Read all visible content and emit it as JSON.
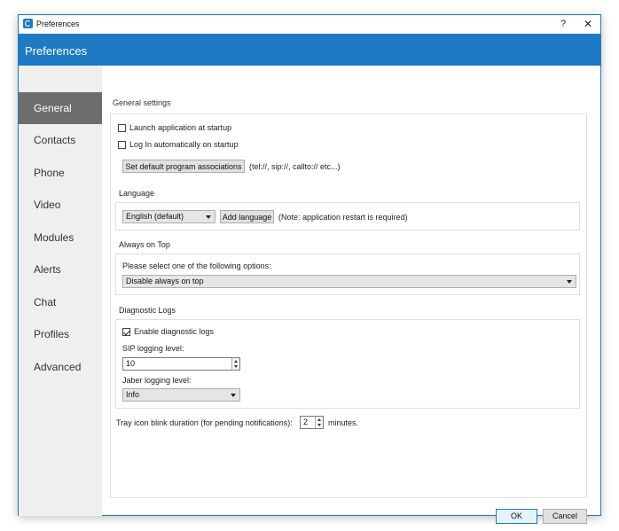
{
  "window": {
    "title": "Preferences",
    "help_label": "?",
    "close_label": "✕"
  },
  "header": {
    "title": "Preferences"
  },
  "sidebar": {
    "items": [
      {
        "label": "General",
        "active": true
      },
      {
        "label": "Contacts"
      },
      {
        "label": "Phone"
      },
      {
        "label": "Video"
      },
      {
        "label": "Modules"
      },
      {
        "label": "Alerts"
      },
      {
        "label": "Chat"
      },
      {
        "label": "Profiles"
      },
      {
        "label": "Advanced"
      }
    ]
  },
  "general": {
    "section_title": "General settings",
    "launch_at_startup": {
      "label": "Launch application at startup",
      "checked": false
    },
    "login_on_startup": {
      "label": "Log In automatically on startup",
      "checked": false
    },
    "set_default_button": "Set default program associations",
    "associations_note": "(tel://, sip://, callto:// etc...)"
  },
  "language": {
    "section_title": "Language",
    "selected": "English (default)",
    "add_button": "Add language",
    "note": "(Note: application restart is required)"
  },
  "always_on_top": {
    "section_title": "Always on Top",
    "prompt": "Please select one of the following options:",
    "selected": "Disable always on top"
  },
  "diagnostic_logs": {
    "section_title": "Diagnostic Logs",
    "enable": {
      "label": "Enable diagnostic logs",
      "checked": true
    },
    "sip_label": "SIP logging level:",
    "sip_value": "10",
    "jabber_label": "Jaber logging level:",
    "jabber_selected": "Info"
  },
  "tray": {
    "label": "Tray icon blink duration (for pending notifications):",
    "value": "2",
    "unit": "minutes."
  },
  "footer": {
    "ok_label": "OK",
    "cancel_label": "Cancel"
  },
  "colors": {
    "accent": "#1e7ac2",
    "sidebar_active": "#6d6d6d",
    "sidebar_bg": "#efefef"
  }
}
